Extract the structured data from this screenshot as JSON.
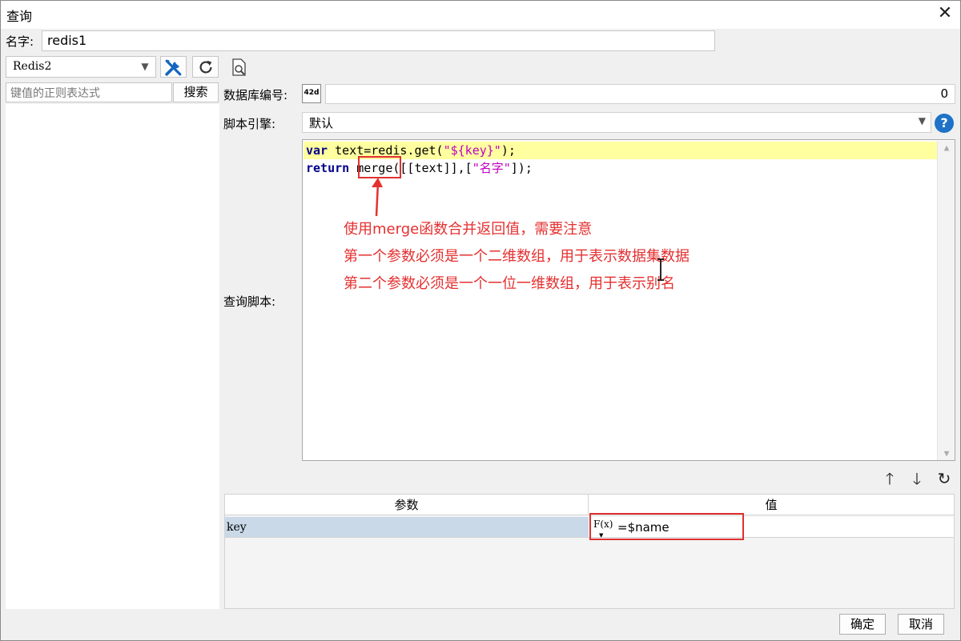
{
  "window": {
    "title": "查询",
    "close_glyph": "✕"
  },
  "name_row": {
    "label": "名字:",
    "value": "redis1"
  },
  "left_panel": {
    "datasource": "Redis2",
    "regex_placeholder": "键值的正则表达式",
    "search_label": "搜索",
    "icons": [
      "wrench-icon",
      "refresh-icon",
      "preview-icon"
    ]
  },
  "form": {
    "db_label": "数据库编号:",
    "db_icon_text": "42d",
    "db_value": "0",
    "engine_label": "脚本引擎:",
    "engine_value": "默认",
    "script_label": "查询脚本:"
  },
  "code": {
    "line1": {
      "kw": "var",
      "a": " text=redis.get(",
      "str": "\"${key}\"",
      "b": ");"
    },
    "line2": {
      "kw": "return",
      "a": " merge([[text]],[",
      "str": "\"名字\"",
      "b": "]);"
    }
  },
  "annotations": {
    "note1": "使用merge函数合并返回值，需要注意",
    "note2": "第一个参数必须是一个二维数组，用于表示数据集数据",
    "note3": "第二个参数必须是一个一位一维数组，用于表示别名",
    "color": "#e53030"
  },
  "param_toolbar": {
    "up": "🡑",
    "down": "🡓",
    "refresh": "↻"
  },
  "param_table": {
    "headers": [
      "参数",
      "值"
    ],
    "rows": [
      {
        "name": "key",
        "fx": "F(x)",
        "value": "=$name"
      }
    ]
  },
  "footer": {
    "ok": "确定",
    "cancel": "取消"
  }
}
